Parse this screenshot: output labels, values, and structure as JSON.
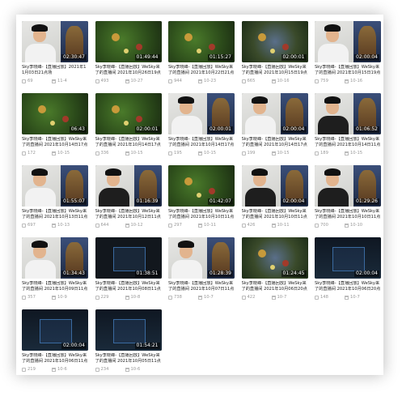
{
  "cards": [
    {
      "kind": "cam",
      "shirt": "light",
      "duration": "02:30:47",
      "title": "Sky李晓峰-【直播回放】2021年11月03日21点场",
      "views": "69",
      "date": "11-4"
    },
    {
      "kind": "map",
      "variant": "green",
      "duration": "01:49:44",
      "title": "Sky李晓峰-【直播回放】WeSky来了的直播间 2021年10月26日19点",
      "views": "493",
      "date": "10-27"
    },
    {
      "kind": "map",
      "variant": "green",
      "duration": "01:15:27",
      "title": "Sky李晓峰-【直播回放】WeSky来了的直播间 2021年10月22日21点",
      "views": "944",
      "date": "10-23"
    },
    {
      "kind": "map",
      "variant": "blue",
      "duration": "02:00:01",
      "title": "Sky李晓峰-【直播回放】WeSky来了的直播间 2021年10月15日19点",
      "views": "665",
      "date": "10-16"
    },
    {
      "kind": "cam",
      "shirt": "light",
      "duration": "02:00:04",
      "title": "Sky李晓峰-【直播回放】WeSky来了的直播间 2021年10月15日19点",
      "views": "759",
      "date": "10-16"
    },
    {
      "kind": "map",
      "variant": "green",
      "duration": "06:43",
      "title": "Sky李晓峰-【直播回放】WeSky来了的直播间 2021年10月14日17点",
      "views": "172",
      "date": "10-15"
    },
    {
      "kind": "map",
      "variant": "green",
      "duration": "02:00:01",
      "title": "Sky李晓峰-【直播回放】WeSky来了的直播间 2021年10月14日17点",
      "views": "336",
      "date": "10-15"
    },
    {
      "kind": "cam",
      "shirt": "light",
      "duration": "02:00:01",
      "title": "Sky李晓峰-【直播回放】WeSky来了的直播间 2021年10月14日17点",
      "views": "195",
      "date": "10-15"
    },
    {
      "kind": "cam",
      "shirt": "light",
      "duration": "02:00:04",
      "title": "Sky李晓峰-【直播回放】WeSky来了的直播间 2021年10月14日17点",
      "views": "199",
      "date": "10-15"
    },
    {
      "kind": "cam",
      "shirt": "dark",
      "duration": "01:06:52",
      "title": "Sky李晓峰-【直播回放】WeSky来了的直播间 2021年10月14日11点",
      "views": "189",
      "date": "10-15"
    },
    {
      "kind": "cam",
      "shirt": "light",
      "duration": "01:55:07",
      "title": "Sky李晓峰-【直播回放】WeSky来了的直播间 2021年10月13日11点",
      "views": "697",
      "date": "10-13"
    },
    {
      "kind": "cam",
      "shirt": "dark",
      "duration": "01:16:39",
      "title": "Sky李晓峰-【直播回放】WeSky来了的直播间 2021年10月12日11点",
      "views": "644",
      "date": "10-12"
    },
    {
      "kind": "map",
      "variant": "green",
      "duration": "01:42:07",
      "title": "Sky李晓峰-【直播回放】WeSky来了的直播间 2021年10月10日11点",
      "views": "297",
      "date": "10-11"
    },
    {
      "kind": "cam",
      "shirt": "dark",
      "duration": "02:00:04",
      "title": "Sky李晓峰-【直播回放】WeSky来了的直播间 2021年10月10日11点",
      "views": "426",
      "date": "10-11"
    },
    {
      "kind": "cam",
      "shirt": "dark",
      "duration": "01:29:26",
      "title": "Sky李晓峰-【直播回放】WeSky来了的直播间 2021年10月10日11点",
      "views": "700",
      "date": "10-10"
    },
    {
      "kind": "cam",
      "shirt": "light",
      "duration": "01:34:43",
      "title": "Sky李晓峰-【直播回放】WeSky来了的直播间 2021年10月09日11点",
      "views": "357",
      "date": "10-9"
    },
    {
      "kind": "map",
      "variant": "dark",
      "duration": "01:38:51",
      "title": "Sky李晓峰-【直播回放】WeSky来了的直播间 2021年10月08日11点",
      "views": "229",
      "date": "10-8"
    },
    {
      "kind": "cam",
      "shirt": "light",
      "duration": "01:28:39",
      "title": "Sky李晓峰-【直播回放】WeSky来了的直播间 2021年10月07日11点",
      "views": "738",
      "date": "10-7"
    },
    {
      "kind": "map",
      "variant": "blue",
      "duration": "01:24:45",
      "title": "Sky李晓峰-【直播回放】WeSky来了的直播间 2021年10月06日20点",
      "views": "422",
      "date": "10-7"
    },
    {
      "kind": "map",
      "variant": "dark2",
      "duration": "02:00:04",
      "title": "Sky李晓峰-【直播回放】WeSky来了的直播间 2021年10月06日20点",
      "views": "148",
      "date": "10-7"
    },
    {
      "kind": "map",
      "variant": "dark2",
      "duration": "02:00:04",
      "title": "Sky李晓峰-【直播回放】WeSky来了的直播间 2021年10月06日11点",
      "views": "219",
      "date": "10-6"
    },
    {
      "kind": "map",
      "variant": "dark2",
      "duration": "01:54:21",
      "title": "Sky李晓峰-【直播回放】WeSky来了的直播间 2021年10月05日11点",
      "views": "234",
      "date": "10-6"
    }
  ]
}
